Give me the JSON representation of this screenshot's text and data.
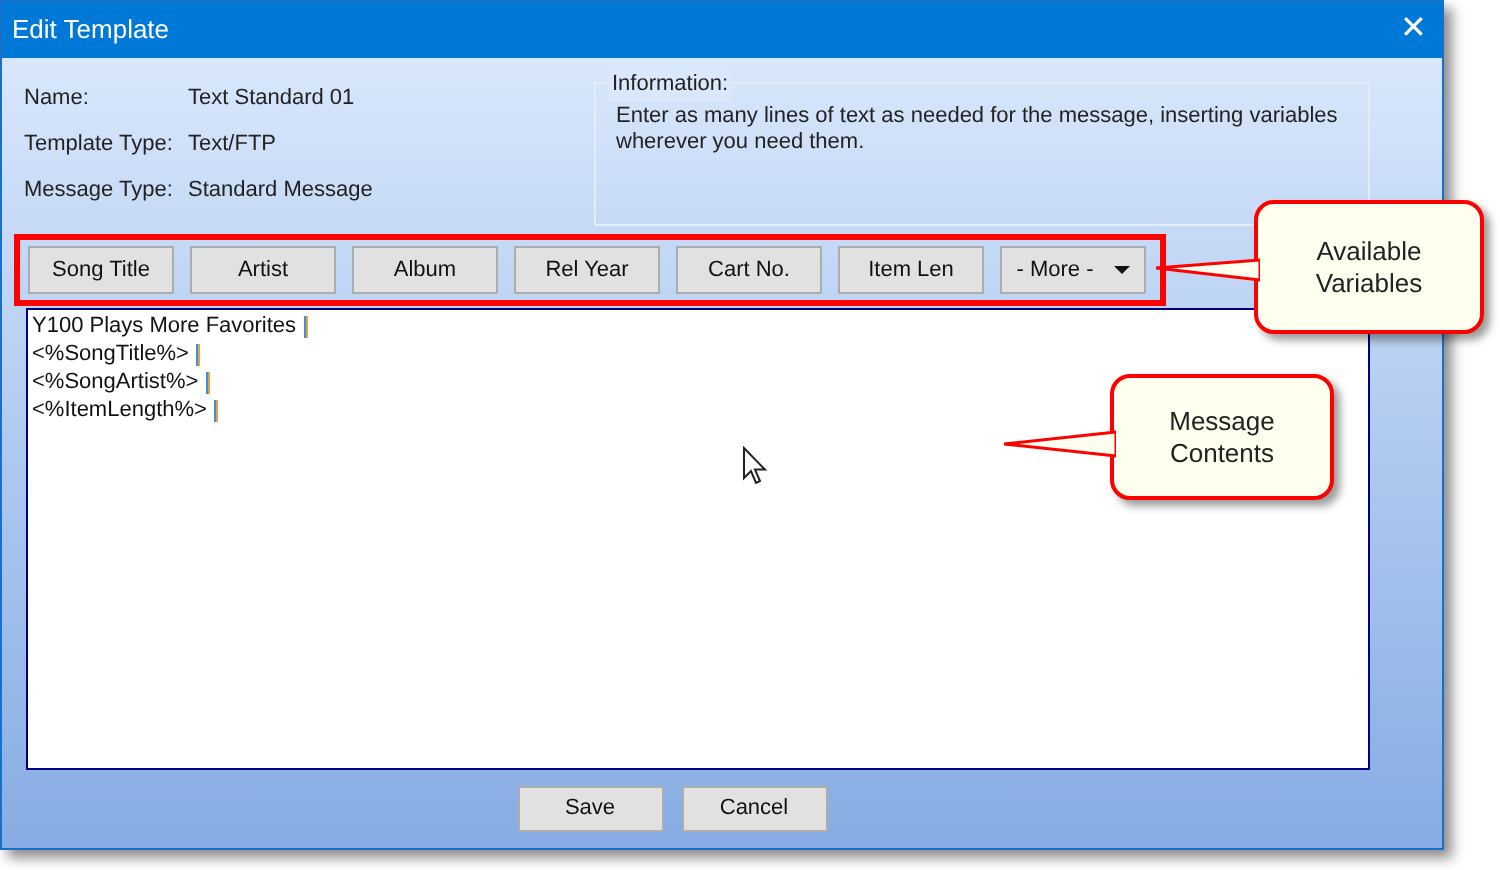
{
  "window": {
    "title": "Edit Template",
    "close": "✕"
  },
  "fields": [
    {
      "label": "Name:",
      "value": "Text Standard 01"
    },
    {
      "label": "Template Type:",
      "value": "Text/FTP"
    },
    {
      "label": "Message Type:",
      "value": "Standard Message"
    }
  ],
  "information": {
    "label": "Information:",
    "text": "Enter as many lines of text as needed for the message, inserting variables wherever you need them."
  },
  "variable_buttons": [
    {
      "kind": "button",
      "label": "Song Title"
    },
    {
      "kind": "button",
      "label": "Artist"
    },
    {
      "kind": "button",
      "label": "Album"
    },
    {
      "kind": "button",
      "label": "Rel Year"
    },
    {
      "kind": "button",
      "label": "Cart No."
    },
    {
      "kind": "button",
      "label": "Item Len"
    },
    {
      "kind": "dropdown",
      "label": "- More -"
    }
  ],
  "message_lines": [
    "Y100 Plays More Favorites",
    "<%SongTitle%>",
    "<%SongArtist%>",
    "<%ItemLength%>"
  ],
  "buttons": [
    "Save",
    "Cancel"
  ],
  "callouts": [
    {
      "text": "Available Variables"
    },
    {
      "text": "Message Contents"
    }
  ]
}
